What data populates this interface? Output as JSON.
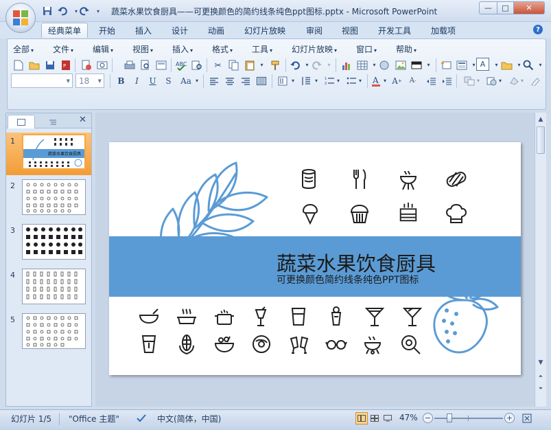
{
  "window": {
    "title": "蔬菜水果饮食厨具——可更换颜色的简约线条纯色ppt图标.pptx - Microsoft PowerPoint",
    "minimize": "—",
    "maximize": "□",
    "close": "✕"
  },
  "quick_access": [
    "save-icon",
    "undo-icon",
    "redo-icon"
  ],
  "ribbon_tabs": [
    "经典菜单",
    "开始",
    "插入",
    "设计",
    "动画",
    "幻灯片放映",
    "审阅",
    "视图",
    "开发工具",
    "加载项"
  ],
  "active_tab": "经典菜单",
  "help_icon": "?",
  "menu_bar": [
    "全部",
    "文件",
    "编辑",
    "视图",
    "插入",
    "格式",
    "工具",
    "幻灯片放映",
    "窗口",
    "帮助"
  ],
  "format": {
    "font_name": "",
    "font_size": "18",
    "bold": "B",
    "italic": "I",
    "underline": "U",
    "strike": "S",
    "case": "Aa"
  },
  "slides_pane": {
    "close": "✕",
    "numbers": [
      "1",
      "2",
      "3",
      "4",
      "5"
    ],
    "selected": 1
  },
  "slide": {
    "title": "蔬菜水果饮食厨具",
    "subtitle": "可更换颜色简约线条纯色PPT图标",
    "accent_color": "#5b9bd5"
  },
  "thumb1": {
    "title": "蔬菜水果饮食厨具"
  },
  "status": {
    "slide_info": "幻灯片 1/5",
    "theme": "\"Office 主题\"",
    "language": "中文(简体，中国)",
    "zoom": "47%",
    "zoom_minus": "−",
    "zoom_plus": "+"
  }
}
